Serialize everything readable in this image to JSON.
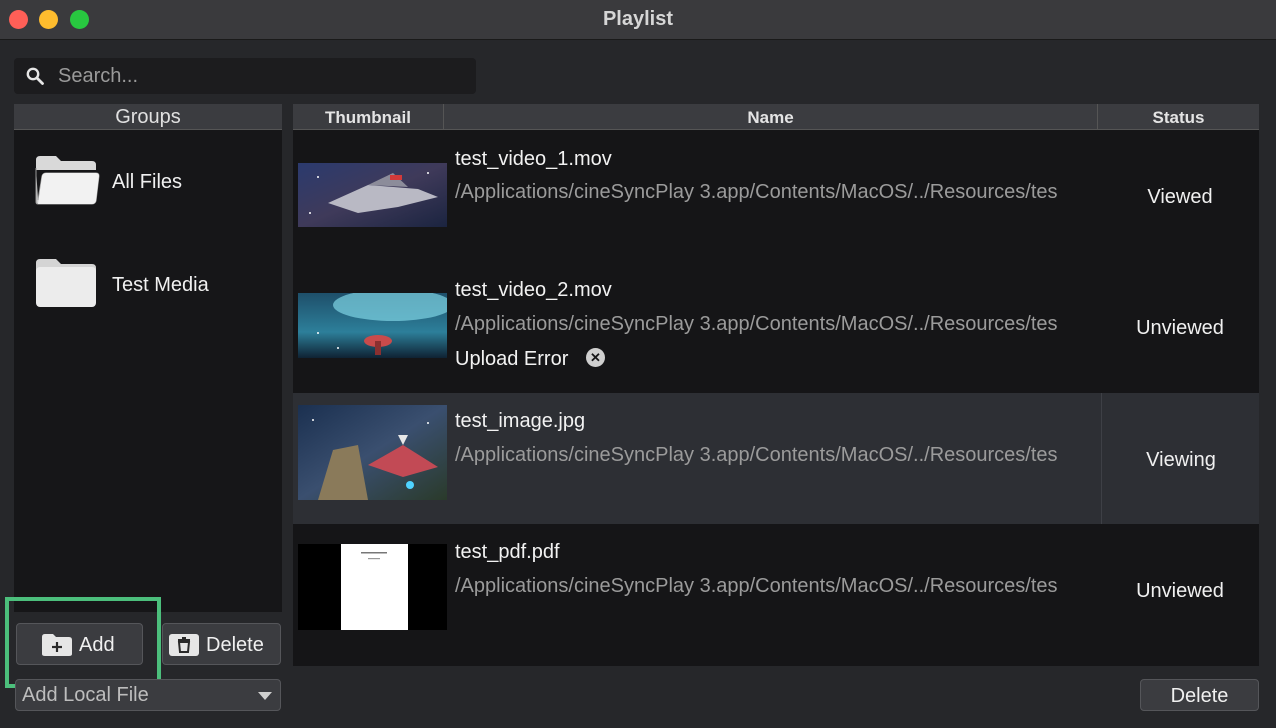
{
  "window": {
    "title": "Playlist"
  },
  "search": {
    "placeholder": "Search..."
  },
  "groups": {
    "header": "Groups",
    "items": [
      {
        "label": "All Files",
        "icon": "folder-open-icon"
      },
      {
        "label": "Test Media",
        "icon": "folder-icon"
      }
    ],
    "add_label": "Add",
    "delete_label": "Delete",
    "add_source_selected": "Add Local File"
  },
  "table": {
    "columns": [
      "Thumbnail",
      "Name",
      "Status"
    ],
    "rows": [
      {
        "name": "test_video_1.mov",
        "path": "/Applications/cineSyncPlay 3.app/Contents/MacOS/../Resources/tes",
        "status": "Viewed",
        "error": "",
        "selected": false
      },
      {
        "name": "test_video_2.mov",
        "path": "/Applications/cineSyncPlay 3.app/Contents/MacOS/../Resources/tes",
        "status": "Unviewed",
        "error": "Upload Error",
        "selected": false
      },
      {
        "name": "test_image.jpg",
        "path": "/Applications/cineSyncPlay 3.app/Contents/MacOS/../Resources/tes",
        "status": "Viewing",
        "error": "",
        "selected": true
      },
      {
        "name": "test_pdf.pdf",
        "path": "/Applications/cineSyncPlay 3.app/Contents/MacOS/../Resources/tes",
        "status": "Unviewed",
        "error": "",
        "selected": false
      }
    ]
  },
  "footer": {
    "delete_label": "Delete"
  },
  "colors": {
    "highlight": "#4cbf7c",
    "selected_row": "#2d2f34"
  }
}
